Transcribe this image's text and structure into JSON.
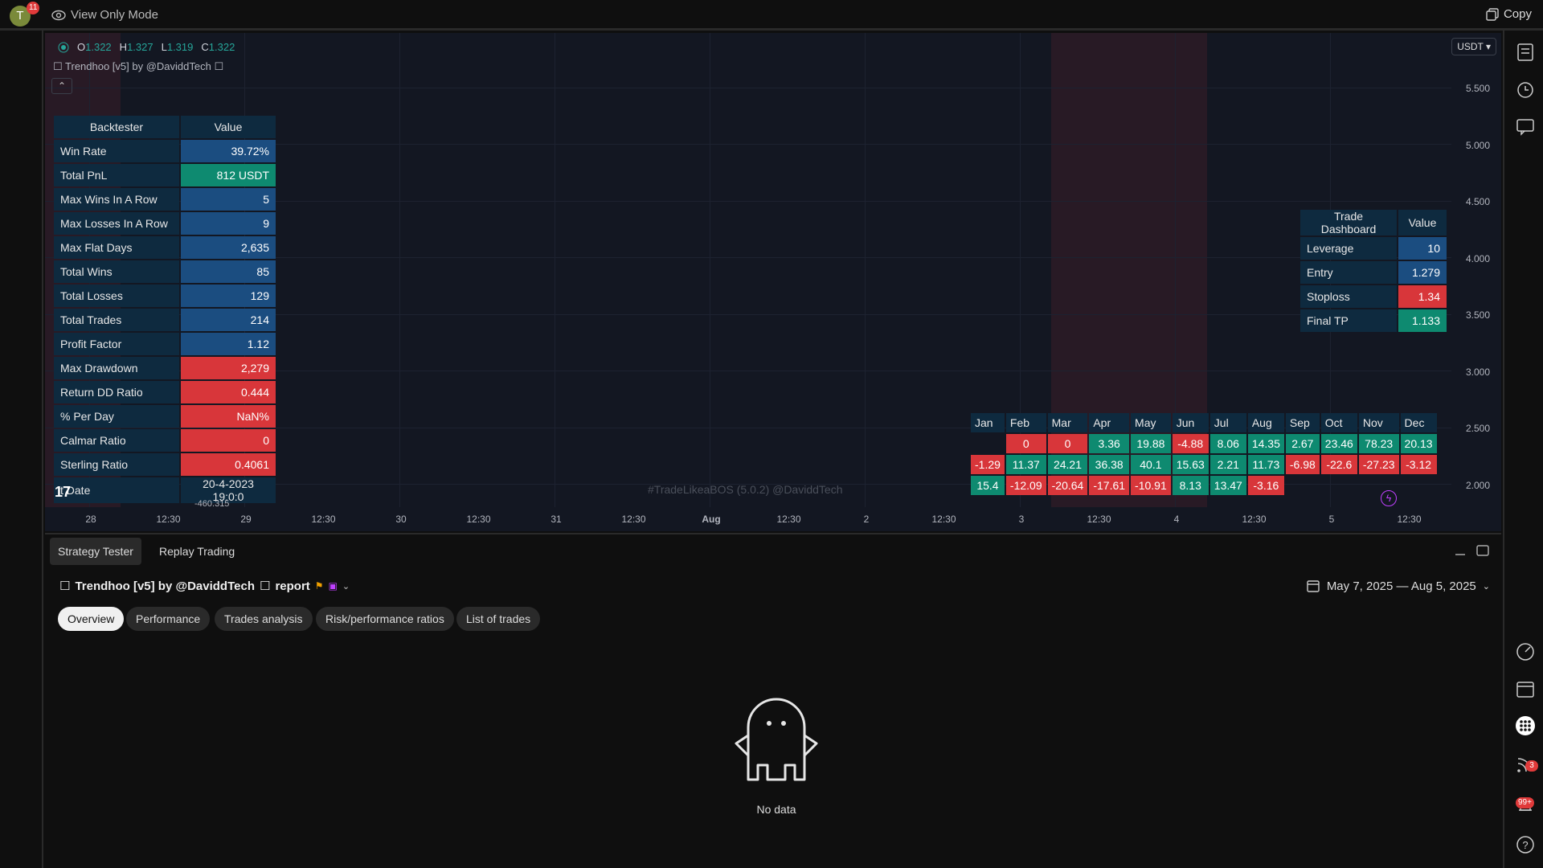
{
  "topbar": {
    "avatar_letter": "T",
    "avatar_badge": "11",
    "view_mode": "View Only Mode",
    "copy_label": "Copy"
  },
  "chart": {
    "ohlc": {
      "o_label": "O",
      "o": "1.322",
      "h_label": "H",
      "h": "1.327",
      "l_label": "L",
      "l": "1.319",
      "c_label": "C",
      "c": "1.322"
    },
    "indicator_title": "Trendhoo [v5] by @DaviddTech",
    "currency": "USDT",
    "y_ticks": [
      "5.500",
      "5.000",
      "4.500",
      "4.000",
      "3.500",
      "3.000",
      "2.500",
      "2.000"
    ],
    "x_ticks": [
      "28",
      "12:30",
      "29",
      "12:30",
      "30",
      "12:30",
      "31",
      "12:30",
      "Aug",
      "12:30",
      "2",
      "12:30",
      "3",
      "12:30",
      "4",
      "12:30",
      "5",
      "12:30"
    ],
    "watermark": "#TradeLikeaBOS (5.0.2) @DaviddTech",
    "price_under": "-460.315",
    "backtester": {
      "header": [
        "Backtester",
        "Value"
      ],
      "rows": [
        {
          "label": "Win Rate",
          "value": "39.72%",
          "tone": "blue"
        },
        {
          "label": "Total PnL",
          "value": "812 USDT",
          "tone": "green"
        },
        {
          "label": "Max Wins In A Row",
          "value": "5",
          "tone": "blue"
        },
        {
          "label": "Max Losses In A Row",
          "value": "9",
          "tone": "blue"
        },
        {
          "label": "Max Flat Days",
          "value": "2,635",
          "tone": "blue"
        },
        {
          "label": "Total Wins",
          "value": "85",
          "tone": "blue"
        },
        {
          "label": "Total Losses",
          "value": "129",
          "tone": "blue"
        },
        {
          "label": "Total Trades",
          "value": "214",
          "tone": "blue"
        },
        {
          "label": "Profit Factor",
          "value": "1.12",
          "tone": "blue"
        },
        {
          "label": "Max Drawdown",
          "value": "2,279",
          "tone": "red"
        },
        {
          "label": "Return DD Ratio",
          "value": "0.444",
          "tone": "red"
        },
        {
          "label": "% Per Day",
          "value": "NaN%",
          "tone": "red"
        },
        {
          "label": "Calmar Ratio",
          "value": "0",
          "tone": "red"
        },
        {
          "label": "Sterling Ratio",
          "value": "0.4061",
          "tone": "red"
        },
        {
          "label": "t Date",
          "value": "20-4-2023 19:0:0",
          "tone": "navy"
        }
      ]
    },
    "trade_dashboard": {
      "header": [
        "Trade Dashboard",
        "Value"
      ],
      "rows": [
        {
          "label": "Leverage",
          "value": "10",
          "tone": "blue"
        },
        {
          "label": "Entry",
          "value": "1.279",
          "tone": "blue"
        },
        {
          "label": "Stoploss",
          "value": "1.34",
          "tone": "red"
        },
        {
          "label": "Final TP",
          "value": "1.133",
          "tone": "green"
        }
      ]
    },
    "monthly": {
      "months": [
        "Jan",
        "Feb",
        "Mar",
        "Apr",
        "May",
        "Jun",
        "Jul",
        "Aug",
        "Sep",
        "Oct",
        "Nov",
        "Dec"
      ],
      "rows": [
        [
          "",
          "0",
          "0",
          "3.36",
          "19.88",
          "-4.88",
          "8.06",
          "14.35",
          "2.67",
          "23.46",
          "78.23",
          "20.13"
        ],
        [
          "-1.29",
          "11.37",
          "24.21",
          "36.38",
          "40.1",
          "15.63",
          "2.21",
          "11.73",
          "-6.98",
          "-22.6",
          "-27.23",
          "-3.12"
        ],
        [
          "15.4",
          "-12.09",
          "-20.64",
          "-17.61",
          "-10.91",
          "8.13",
          "13.47",
          "-3.16",
          "",
          "",
          "",
          ""
        ]
      ]
    }
  },
  "bottom": {
    "tabs": [
      "Strategy Tester",
      "Replay Trading"
    ],
    "report_name": "Trendhoo [v5] by @DaviddTech",
    "report_word": "report",
    "date_range": "May 7, 2025 — Aug 5, 2025",
    "pills": [
      "Overview",
      "Performance",
      "Trades analysis",
      "Risk/performance ratios",
      "List of trades"
    ],
    "empty_text": "No data"
  },
  "rail": {
    "feed_badge": "3",
    "alerts_badge": "99+"
  },
  "colors": {
    "chart_bg": "#131722",
    "cell_blue": "#1b4d80",
    "cell_red": "#d8363a",
    "cell_green": "#0e8a70",
    "header_navy": "#0e2a3f"
  }
}
